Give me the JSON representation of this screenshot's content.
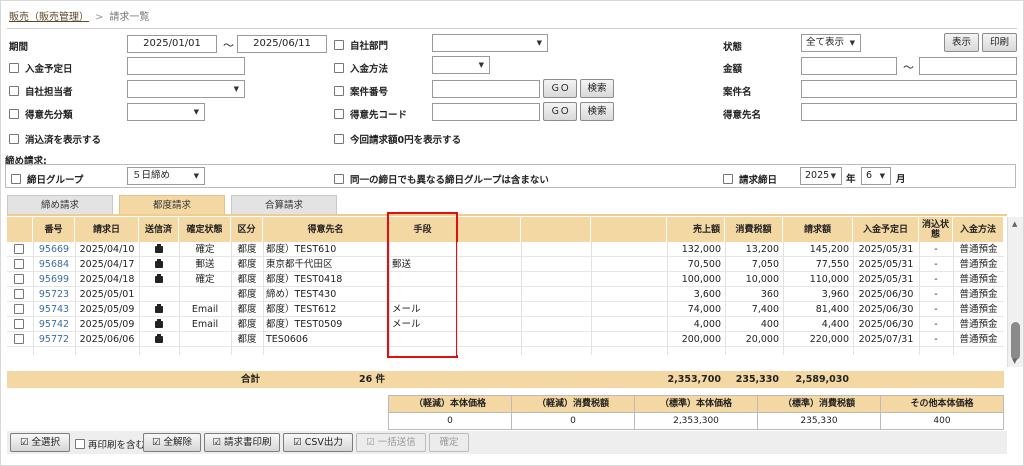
{
  "breadcrumb": {
    "root": "販売（販売管理）",
    "current": "請求一覧"
  },
  "filters": {
    "period_label": "期間",
    "period_from": "2025/01/01",
    "period_tilde": "～",
    "period_to": "2025/06/11",
    "own_dept_label": "自社部門",
    "status_label": "状態",
    "status_value": "全て表示",
    "show_button": "表示",
    "print_button": "印刷",
    "payment_due_label": "入金予定日",
    "payment_method_label": "入金方法",
    "amount_label": "金額",
    "amount_tilde": "～",
    "own_staff_label": "自社担当者",
    "case_no_label": "案件番号",
    "go_label": "ＧＯ",
    "search_label": "検索",
    "case_name_label": "案件名",
    "customer_class_label": "得意先分類",
    "customer_code_label": "得意先コード",
    "customer_name_label": "得意先名",
    "show_cleared_label": "消込済を表示する",
    "show_zero_label": "今回請求額0円を表示する",
    "closing_title": "締め請求:",
    "closing_group_label": "締日グループ",
    "closing_group_value": "５日締め",
    "exclude_label": "同一の締日でも異なる締日グループは含まない",
    "closing_date_label": "請求締日",
    "year_value": "2025",
    "year_unit": "年",
    "month_value": "6",
    "month_unit": "月"
  },
  "tabs": [
    "締め請求",
    "都度請求",
    "合算請求"
  ],
  "grid": {
    "headers": [
      "番号",
      "請求日",
      "送信済",
      "確定状態",
      "区分",
      "得意先名",
      "手段",
      "売上額",
      "消費税額",
      "請求額",
      "入金予定日",
      "消込状態",
      "入金方法"
    ],
    "rows": [
      {
        "no": "95669",
        "date": "2025/04/10",
        "sent": "print",
        "state": "確定",
        "kind": "都度",
        "customer": "都度）TEST610",
        "method": "",
        "sales": "132,000",
        "tax": "13,200",
        "billed": "145,200",
        "due": "2025/05/31",
        "cleared": "-",
        "pay": "普通預金"
      },
      {
        "no": "95684",
        "date": "2025/04/17",
        "sent": "print",
        "state": "郵送",
        "kind": "都度",
        "customer": "東京都千代田区",
        "method": "郵送",
        "sales": "70,500",
        "tax": "7,050",
        "billed": "77,550",
        "due": "2025/05/31",
        "cleared": "-",
        "pay": "普通預金"
      },
      {
        "no": "95699",
        "date": "2025/04/18",
        "sent": "print",
        "state": "確定",
        "kind": "都度",
        "customer": "都度）TEST0418",
        "method": "",
        "sales": "100,000",
        "tax": "10,000",
        "billed": "110,000",
        "due": "2025/05/31",
        "cleared": "-",
        "pay": "普通預金"
      },
      {
        "no": "95723",
        "date": "2025/05/01",
        "sent": "",
        "state": "",
        "kind": "都度",
        "customer": "締め）TEST430",
        "method": "",
        "sales": "3,600",
        "tax": "360",
        "billed": "3,960",
        "due": "2025/06/30",
        "cleared": "-",
        "pay": "普通預金"
      },
      {
        "no": "95743",
        "date": "2025/05/09",
        "sent": "print",
        "state": "Email",
        "kind": "都度",
        "customer": "都度）TEST612",
        "method": "メール",
        "sales": "74,000",
        "tax": "7,400",
        "billed": "81,400",
        "due": "2025/06/30",
        "cleared": "-",
        "pay": "普通預金"
      },
      {
        "no": "95742",
        "date": "2025/05/09",
        "sent": "print",
        "state": "Email",
        "kind": "都度",
        "customer": "都度）TEST0509",
        "method": "メール",
        "sales": "4,000",
        "tax": "400",
        "billed": "4,400",
        "due": "2025/06/30",
        "cleared": "-",
        "pay": "普通預金"
      },
      {
        "no": "95772",
        "date": "2025/06/06",
        "sent": "print",
        "state": "",
        "kind": "都度",
        "customer": "TES0606",
        "method": "",
        "sales": "200,000",
        "tax": "20,000",
        "billed": "220,000",
        "due": "2025/07/31",
        "cleared": "-",
        "pay": "普通預金"
      }
    ]
  },
  "totals": {
    "label": "合計",
    "count": "26 件",
    "sales": "2,353,700",
    "tax": "235,330",
    "billed": "2,589,030"
  },
  "summary": {
    "headers": [
      "（軽減）本体価格",
      "（軽減）消費税額",
      "（標準）本体価格",
      "（標準）消費税額",
      "その他本体価格"
    ],
    "values": [
      "0",
      "0",
      "2,353,300",
      "235,330",
      "400"
    ]
  },
  "actions": {
    "select_all": "全選択",
    "reprint": "再印刷を含む",
    "clear_all": "全解除",
    "invoice_print": "請求書印刷",
    "csv_export": "CSV出力",
    "bulk_send": "一括送信",
    "confirm": "確定"
  },
  "colors": {
    "header_bg": "#f4d8a4",
    "highlight": "#e01010",
    "link": "#3a6ea5"
  }
}
